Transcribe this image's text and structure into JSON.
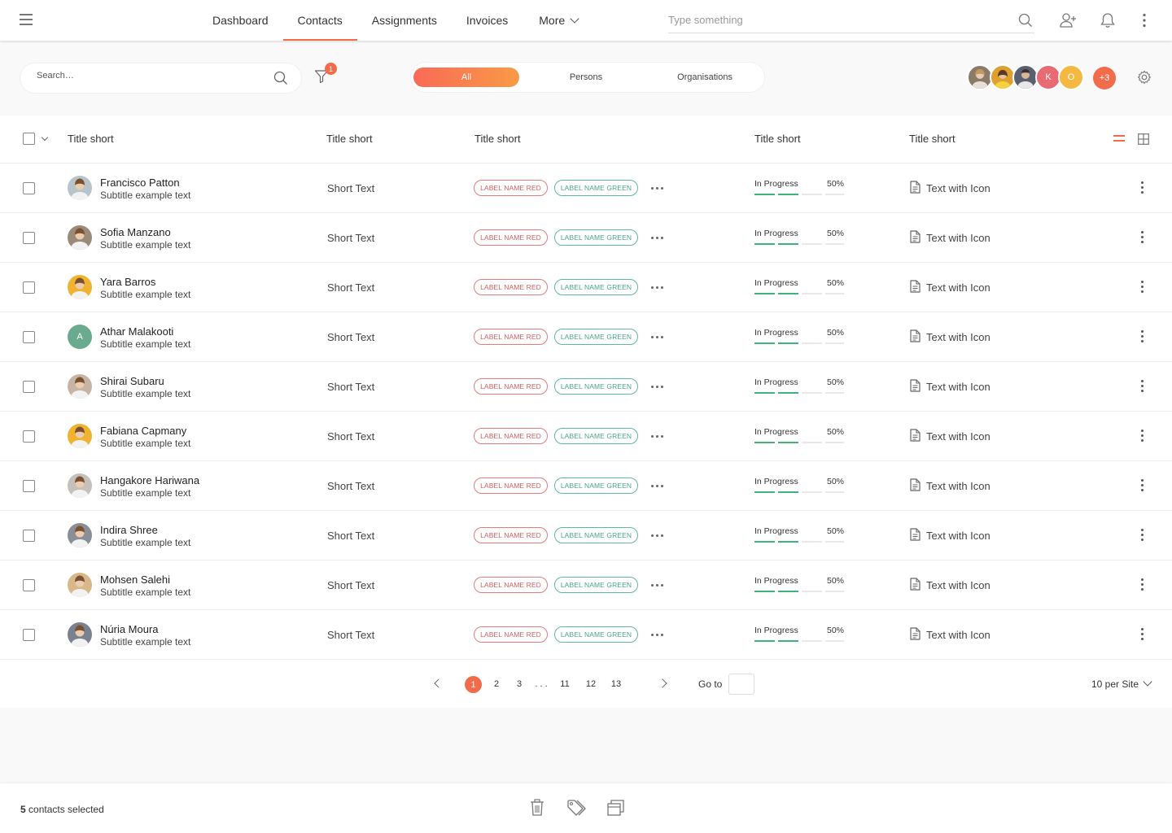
{
  "nav": {
    "items": [
      {
        "label": "Dashboard",
        "active": false
      },
      {
        "label": "Contacts",
        "active": true
      },
      {
        "label": "Assignments",
        "active": false
      },
      {
        "label": "Invoices",
        "active": false
      }
    ],
    "more_label": "More",
    "search_placeholder": "Type something",
    "icons": [
      "search-icon",
      "add-user-icon",
      "bell-icon",
      "more-vertical-icon"
    ]
  },
  "filters": {
    "search_placeholder": "Search…",
    "filter_count": "1",
    "segments": [
      {
        "label": "All",
        "active": true
      },
      {
        "label": "Persons",
        "active": false
      },
      {
        "label": "Organisations",
        "active": false
      }
    ],
    "avatars": [
      {
        "initial": "",
        "color": "#8a7a6a"
      },
      {
        "initial": "",
        "color": "#e0a030"
      },
      {
        "initial": "",
        "color": "#5a6070"
      },
      {
        "initial": "K",
        "color": "#e86a72"
      },
      {
        "initial": "O",
        "color": "#f5b942"
      }
    ],
    "more_count": "+3"
  },
  "table": {
    "headers": [
      "Title short",
      "Title short",
      "Title short",
      "Title short",
      "Title short"
    ],
    "rows": [
      {
        "name": "Francisco Patton",
        "subtitle": "Subtitle example text",
        "short": "Short Text",
        "tag_red": "LABEL NAME RED",
        "tag_green": "LABEL NAME GREEN",
        "status": "In Progress",
        "progress": "50%",
        "icon_text": "Text with Icon",
        "avatar_color": "#b8c4cc",
        "avatar_initial": ""
      },
      {
        "name": "Sofia Manzano",
        "subtitle": "Subtitle example text",
        "short": "Short Text",
        "tag_red": "LABEL NAME RED",
        "tag_green": "LABEL NAME GREEN",
        "status": "In Progress",
        "progress": "50%",
        "icon_text": "Text with Icon",
        "avatar_color": "#9a8a7a",
        "avatar_initial": ""
      },
      {
        "name": "Yara Barros",
        "subtitle": "Subtitle example text",
        "short": "Short Text",
        "tag_red": "LABEL NAME RED",
        "tag_green": "LABEL NAME GREEN",
        "status": "In Progress",
        "progress": "50%",
        "icon_text": "Text with Icon",
        "avatar_color": "#f0b330",
        "avatar_initial": ""
      },
      {
        "name": "Athar Malakooti",
        "subtitle": "Subtitle example text",
        "short": "Short Text",
        "tag_red": "LABEL NAME RED",
        "tag_green": "LABEL NAME GREEN",
        "status": "In Progress",
        "progress": "50%",
        "icon_text": "Text with Icon",
        "avatar_color": "#6aaa8e",
        "avatar_initial": "A"
      },
      {
        "name": "Shirai Subaru",
        "subtitle": "Subtitle example text",
        "short": "Short Text",
        "tag_red": "LABEL NAME RED",
        "tag_green": "LABEL NAME GREEN",
        "status": "In Progress",
        "progress": "50%",
        "icon_text": "Text with Icon",
        "avatar_color": "#c8b4a4",
        "avatar_initial": ""
      },
      {
        "name": "Fabiana Capmany",
        "subtitle": "Subtitle example text",
        "short": "Short Text",
        "tag_red": "LABEL NAME RED",
        "tag_green": "LABEL NAME GREEN",
        "status": "In Progress",
        "progress": "50%",
        "icon_text": "Text with Icon",
        "avatar_color": "#f0b330",
        "avatar_initial": ""
      },
      {
        "name": "Hangakore Hariwana",
        "subtitle": "Subtitle example text",
        "short": "Short Text",
        "tag_red": "LABEL NAME RED",
        "tag_green": "LABEL NAME GREEN",
        "status": "In Progress",
        "progress": "50%",
        "icon_text": "Text with Icon",
        "avatar_color": "#c4c0bc",
        "avatar_initial": ""
      },
      {
        "name": "Indira Shree",
        "subtitle": "Subtitle example text",
        "short": "Short Text",
        "tag_red": "LABEL NAME RED",
        "tag_green": "LABEL NAME GREEN",
        "status": "In Progress",
        "progress": "50%",
        "icon_text": "Text with Icon",
        "avatar_color": "#8a8e96",
        "avatar_initial": ""
      },
      {
        "name": "Mohsen Salehi",
        "subtitle": "Subtitle example text",
        "short": "Short Text",
        "tag_red": "LABEL NAME RED",
        "tag_green": "LABEL NAME GREEN",
        "status": "In Progress",
        "progress": "50%",
        "icon_text": "Text with Icon",
        "avatar_color": "#d8b888",
        "avatar_initial": ""
      },
      {
        "name": "Núria Moura",
        "subtitle": "Subtitle example text",
        "short": "Short Text",
        "tag_red": "LABEL NAME RED",
        "tag_green": "LABEL NAME GREEN",
        "status": "In Progress",
        "progress": "50%",
        "icon_text": "Text with Icon",
        "avatar_color": "#7a8290",
        "avatar_initial": ""
      }
    ]
  },
  "pagination": {
    "pages": [
      {
        "label": "1",
        "active": true
      },
      {
        "label": "2",
        "active": false
      },
      {
        "label": "3",
        "active": false
      },
      {
        "label": ". . .",
        "active": false
      },
      {
        "label": "11",
        "active": false
      },
      {
        "label": "12",
        "active": false
      },
      {
        "label": "13",
        "active": false
      }
    ],
    "goto_label": "Go to",
    "goto_value": "",
    "per_site": "10 per Site"
  },
  "bottom": {
    "selected_count": "5",
    "selected_text": "contacts selected",
    "actions": [
      "trash-icon",
      "tags-icon",
      "copy-icon"
    ]
  },
  "colors": {
    "accent": "#f26b4a",
    "green": "#4ba587",
    "red": "#d46060"
  }
}
